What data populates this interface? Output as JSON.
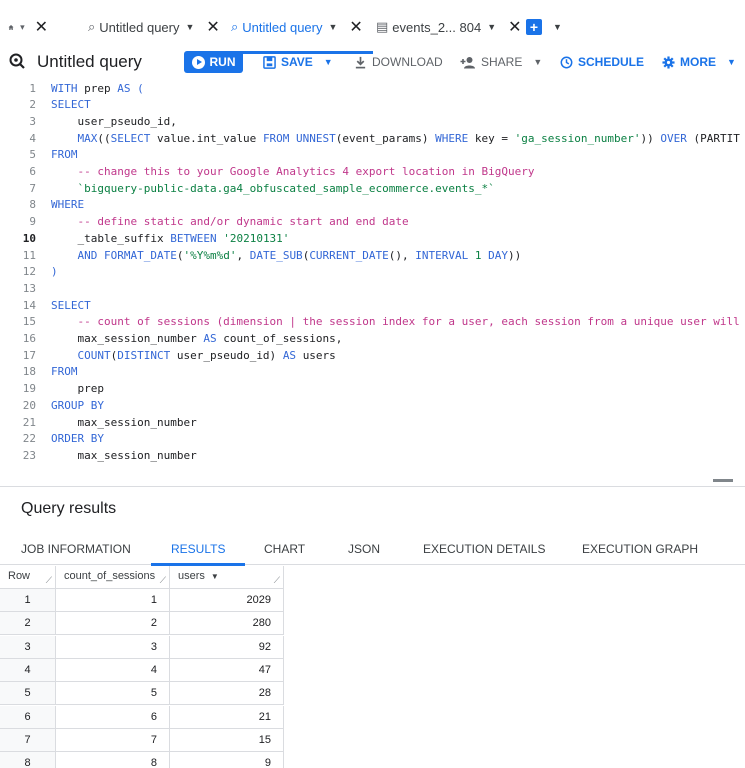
{
  "tabs": {
    "home_caret": "▾",
    "items": [
      {
        "label": "Untitled query",
        "icon": "query-icon",
        "active": false
      },
      {
        "label": "Untitled query",
        "icon": "query-icon",
        "active": true
      },
      {
        "label": "events_2... 804",
        "icon": "table-icon",
        "active": false
      }
    ]
  },
  "toolbar": {
    "title": "Untitled query",
    "run": "RUN",
    "save": "SAVE",
    "download": "DOWNLOAD",
    "share": "SHARE",
    "schedule": "SCHEDULE",
    "more": "MORE"
  },
  "editor": {
    "current_line": 10,
    "lines": [
      [
        [
          "kw",
          "WITH "
        ],
        [
          "",
          "prep "
        ],
        [
          "kw",
          "AS"
        ],
        [
          "kw",
          " ("
        ]
      ],
      [
        [
          "kw",
          "SELECT"
        ]
      ],
      [
        [
          "",
          "    user_pseudo_id,"
        ]
      ],
      [
        [
          "kw",
          "    MAX"
        ],
        [
          "",
          "(("
        ],
        [
          "kw",
          "SELECT "
        ],
        [
          "",
          "value.int_value "
        ],
        [
          "kw",
          "FROM UNNEST"
        ],
        [
          "",
          "(event_params) "
        ],
        [
          "kw",
          "WHERE "
        ],
        [
          "",
          "key = "
        ],
        [
          "st",
          "'ga_session_number'"
        ],
        [
          "",
          "))"
        ],
        [
          "kw",
          " OVER "
        ],
        [
          "",
          "(PARTIT"
        ]
      ],
      [
        [
          "kw",
          "FROM"
        ]
      ],
      [
        [
          "cm",
          "    -- change this to your Google Analytics 4 export location in BigQuery"
        ]
      ],
      [
        [
          "st",
          "    `bigquery-public-data.ga4_obfuscated_sample_ecommerce.events_*`"
        ]
      ],
      [
        [
          "kw",
          "WHERE"
        ]
      ],
      [
        [
          "cm",
          "    -- define static and/or dynamic start and end date"
        ]
      ],
      [
        [
          "",
          "    _table_suffix "
        ],
        [
          "kw",
          "BETWEEN "
        ],
        [
          "st",
          "'20210131'"
        ]
      ],
      [
        [
          "kw",
          "    AND FORMAT_DATE"
        ],
        [
          "",
          "("
        ],
        [
          "st",
          "'%Y%m%d'"
        ],
        [
          "",
          ", "
        ],
        [
          "kw",
          "DATE_SUB"
        ],
        [
          "",
          "("
        ],
        [
          "kw",
          "CURRENT_DATE"
        ],
        [
          "",
          "(), "
        ],
        [
          "kw",
          "INTERVAL "
        ],
        [
          "st",
          "1"
        ],
        [
          "kw",
          " DAY"
        ],
        [
          "",
          "))"
        ]
      ],
      [
        [
          "kw",
          ")"
        ]
      ],
      [
        [
          "",
          ""
        ]
      ],
      [
        [
          "kw",
          "SELECT"
        ]
      ],
      [
        [
          "cm",
          "    -- count of sessions (dimension | the session index for a user, each session from a unique user will"
        ]
      ],
      [
        [
          "",
          "    max_session_number "
        ],
        [
          "kw",
          "AS "
        ],
        [
          "",
          "count_of_sessions,"
        ]
      ],
      [
        [
          "kw",
          "    COUNT"
        ],
        [
          "",
          "("
        ],
        [
          "kw",
          "DISTINCT "
        ],
        [
          "",
          "user_pseudo_id) "
        ],
        [
          "kw",
          "AS "
        ],
        [
          "",
          "users"
        ]
      ],
      [
        [
          "kw",
          "FROM"
        ]
      ],
      [
        [
          "",
          "    prep"
        ]
      ],
      [
        [
          "kw",
          "GROUP BY"
        ]
      ],
      [
        [
          "",
          "    max_session_number"
        ]
      ],
      [
        [
          "kw",
          "ORDER BY"
        ]
      ],
      [
        [
          "",
          "    max_session_number"
        ]
      ]
    ]
  },
  "results": {
    "title": "Query results",
    "tabs": [
      "JOB INFORMATION",
      "RESULTS",
      "CHART",
      "JSON",
      "EXECUTION DETAILS",
      "EXECUTION GRAPH"
    ],
    "active_tab": "RESULTS",
    "columns": [
      "Row",
      "count_of_sessions",
      "users"
    ],
    "rows": [
      [
        "1",
        "1",
        "2029"
      ],
      [
        "2",
        "2",
        "280"
      ],
      [
        "3",
        "3",
        "92"
      ],
      [
        "4",
        "4",
        "47"
      ],
      [
        "5",
        "5",
        "28"
      ],
      [
        "6",
        "6",
        "21"
      ],
      [
        "7",
        "7",
        "15"
      ],
      [
        "8",
        "8",
        "9"
      ]
    ]
  },
  "colors": {
    "accent": "#1a73e8",
    "keyword": "#3367d6",
    "comment": "#c0378b",
    "string": "#0b8043"
  }
}
